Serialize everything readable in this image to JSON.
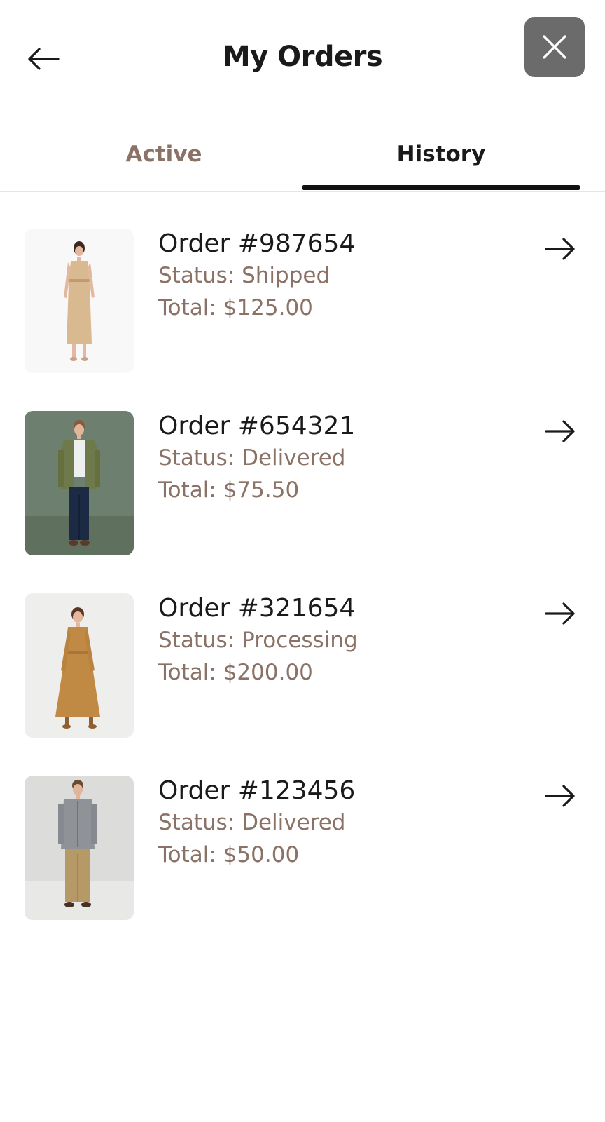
{
  "header": {
    "title": "My Orders",
    "back_icon": "arrow-left-icon",
    "close_icon": "close-icon"
  },
  "tabs": [
    {
      "label": "Active",
      "selected": false
    },
    {
      "label": "History",
      "selected": true
    }
  ],
  "orders": [
    {
      "order_label": "Order #987654",
      "status": "Status: Shipped",
      "total": "Total: $125.00",
      "image": "woman-beige-dress",
      "arrow_icon": "arrow-right-icon"
    },
    {
      "order_label": "Order #654321",
      "status": "Status: Delivered",
      "total": "Total: $75.50",
      "image": "man-olive-jacket",
      "arrow_icon": "arrow-right-icon"
    },
    {
      "order_label": "Order #321654",
      "status": "Status: Processing",
      "total": "Total: $200.00",
      "image": "woman-camel-coat-dress",
      "arrow_icon": "arrow-right-icon"
    },
    {
      "order_label": "Order #123456",
      "status": "Status: Delivered",
      "total": "Total: $50.00",
      "image": "man-grey-jacket-khakis",
      "arrow_icon": "arrow-right-icon"
    }
  ],
  "colors": {
    "accent_text": "#8b7266",
    "primary_text": "#1a1a1a",
    "close_button_bg": "#6b6b6b",
    "tab_indicator": "#111111"
  }
}
